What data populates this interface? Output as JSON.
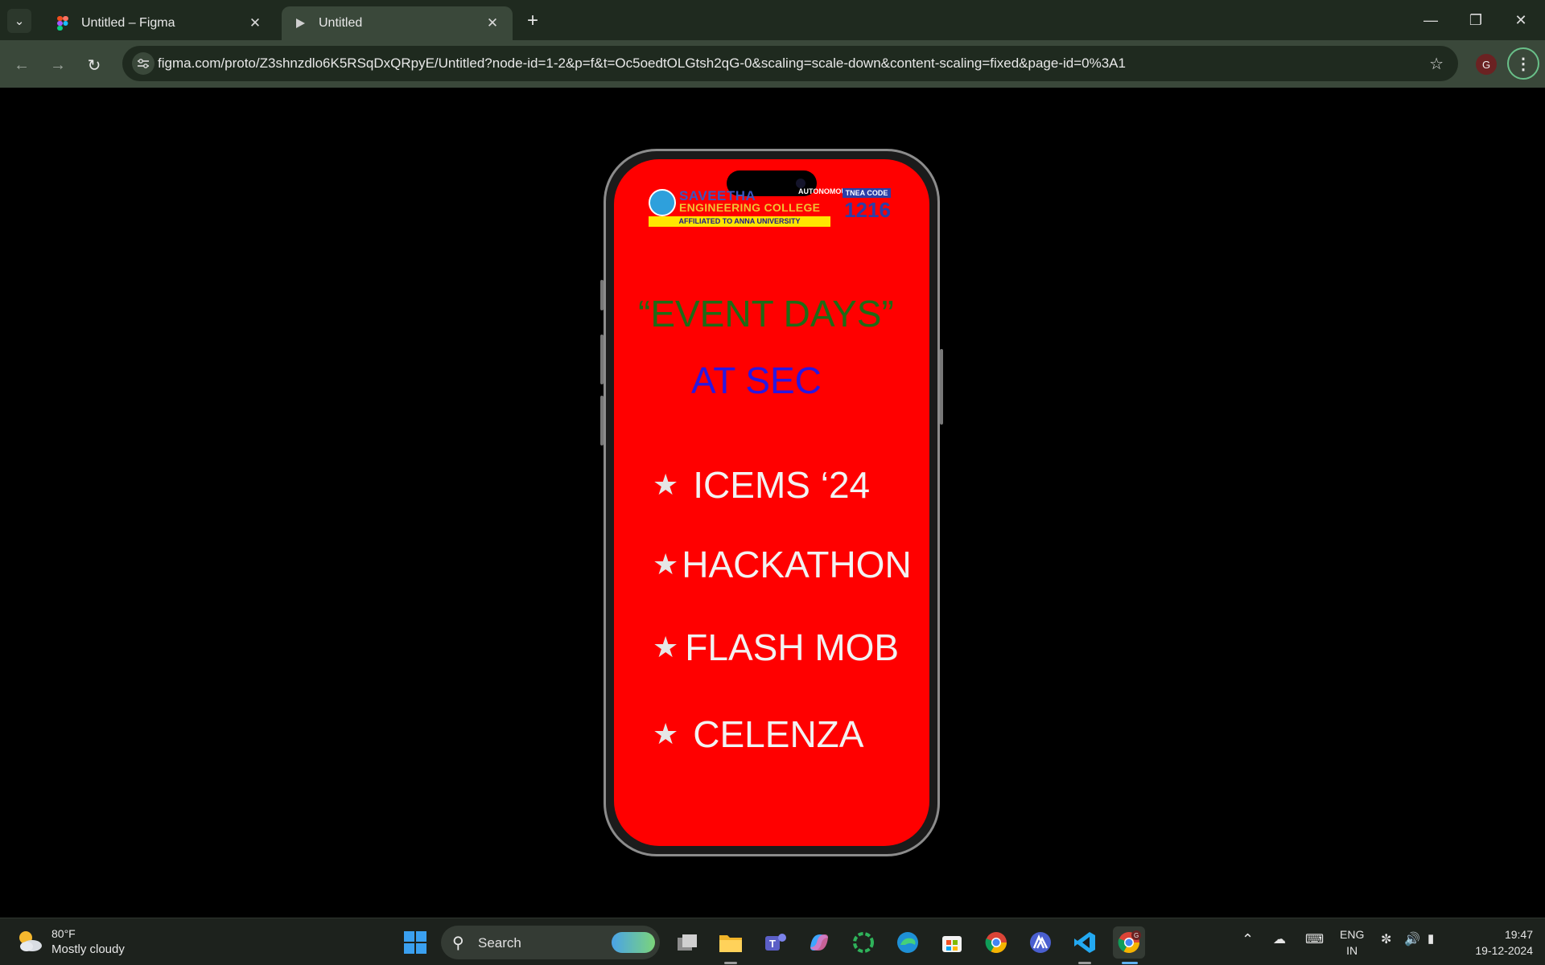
{
  "browser": {
    "tabs": [
      {
        "label": "Untitled – Figma",
        "icon": "figma-icon",
        "active": false
      },
      {
        "label": "Untitled",
        "icon": "play-icon",
        "active": true
      }
    ],
    "url": "figma.com/proto/Z3shnzdlo6K5RSqDxQRpyE/Untitled?node-id=1-2&p=f&t=Oc5oedtOLGtsh2qG-0&scaling=scale-down&content-scaling=fixed&page-id=0%3A1",
    "profile_initial": "G"
  },
  "prototype": {
    "background_color": "#ff0000",
    "logo": {
      "line1": "SAVEETHA",
      "autonomous": "AUTONOMOUS",
      "line2": "ENGINEERING COLLEGE",
      "affiliation": "AFFILIATED TO ANNA UNIVERSITY",
      "tnea_label": "TNEA CODE",
      "tnea_code": "1216"
    },
    "title": "“EVENT DAYS”",
    "subtitle": "AT SEC",
    "bullet": "★",
    "events": [
      "ICEMS ‘24",
      "HACKATHON",
      "FLASH MOB",
      "CELENZA"
    ],
    "colors": {
      "title": "#1e6b16",
      "subtitle": "#2a18e0",
      "events": "#f2f2f2"
    }
  },
  "taskbar": {
    "weather": {
      "temp": "80°F",
      "desc": "Mostly cloudy"
    },
    "search_label": "Search",
    "language": {
      "line1": "ENG",
      "line2": "IN"
    },
    "clock": {
      "time": "19:47",
      "date": "19-12-2024"
    },
    "profile_badge": "G"
  }
}
